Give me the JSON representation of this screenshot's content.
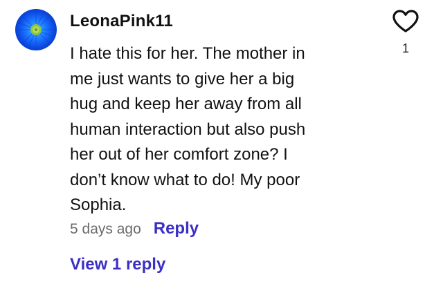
{
  "comment": {
    "username": "LeonaPink11",
    "avatar_icon": "blue-flower-avatar",
    "body_lines": [
      "I hate this for her. The mother in",
      "me just wants to give her a big",
      "hug and keep her away from all",
      "human interaction but also push",
      "her out of her comfort zone? I",
      "don’t know what to do! My poor",
      "Sophia."
    ],
    "timestamp": "5 days ago",
    "reply_label": "Reply",
    "view_replies_label": "View 1 reply",
    "like_icon": "heart-outline-icon",
    "like_count": "1"
  },
  "colors": {
    "link": "#3b2fc4",
    "timestamp": "#6b6b6b",
    "text": "#111111"
  }
}
